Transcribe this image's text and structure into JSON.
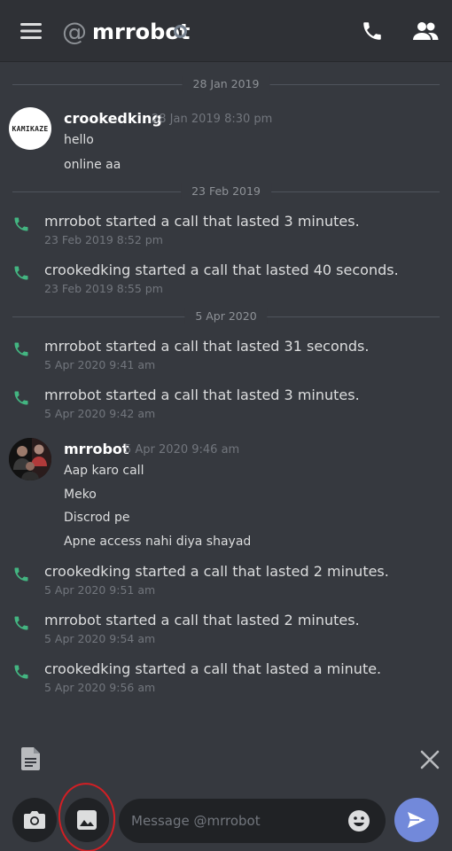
{
  "header": {
    "at_symbol": "@",
    "title": "mrrobot",
    "status": "offline",
    "icons": [
      "menu-icon",
      "phone-icon",
      "members-icon"
    ]
  },
  "dividers": [
    "28 Jan 2019",
    "23 Feb 2019",
    "5 Apr 2020"
  ],
  "group1": {
    "avatar_text": "KAMIKAZE",
    "author": "crookedking",
    "timestamp": "28 Jan 2019 8:30 pm",
    "messages": [
      "hello",
      "online aa"
    ]
  },
  "calls": [
    {
      "text": "mrrobot started a call that lasted 3 minutes.",
      "time": "23 Feb 2019 8:52 pm"
    },
    {
      "text": "crookedking started a call that lasted 40 seconds.",
      "time": "23 Feb 2019 8:55 pm"
    },
    {
      "text": "mrrobot started a call that lasted 31 seconds.",
      "time": "5 Apr 2020 9:41 am"
    },
    {
      "text": "mrrobot started a call that lasted 3 minutes.",
      "time": "5 Apr 2020 9:42 am"
    },
    {
      "text": "crookedking started a call that lasted 2 minutes.",
      "time": "5 Apr 2020 9:51 am"
    },
    {
      "text": "mrrobot started a call that lasted 2 minutes.",
      "time": "5 Apr 2020 9:54 am"
    },
    {
      "text": "crookedking started a call that lasted a minute.",
      "time": "5 Apr 2020 9:56 am"
    }
  ],
  "group2": {
    "author": "mrrobot",
    "timestamp": "5 Apr 2020 9:46 am",
    "messages": [
      "Aap karo call",
      "Meko",
      "Discrod pe",
      "Apne access nahi diya shayad"
    ]
  },
  "composer": {
    "placeholder": "Message @mrrobot"
  },
  "colors": {
    "background": "#36393f",
    "header": "#2f3136",
    "call_icon": "#43b581",
    "accent": "#7289da",
    "highlight": "#d21f24"
  }
}
